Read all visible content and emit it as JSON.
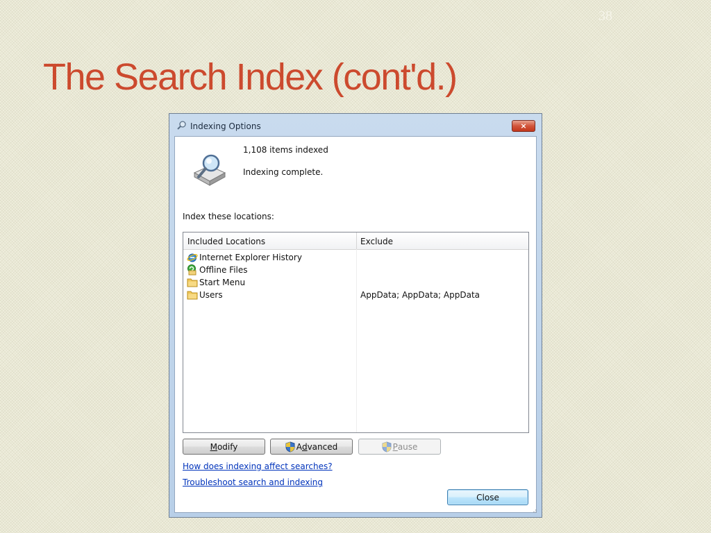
{
  "slide": {
    "number": "38",
    "title": "The Search Index (cont'd.)"
  },
  "window": {
    "title": "Indexing Options",
    "close_glyph": "×"
  },
  "status": {
    "items_indexed": "1,108 items indexed",
    "message": "Indexing complete."
  },
  "locations": {
    "label": "Index these locations:",
    "columns": {
      "included": "Included Locations",
      "exclude": "Exclude"
    },
    "rows": [
      {
        "name": "Internet Explorer History",
        "icon": "internet-explorer-icon",
        "exclude": ""
      },
      {
        "name": "Offline Files",
        "icon": "offline-files-icon",
        "exclude": ""
      },
      {
        "name": "Start Menu",
        "icon": "folder-icon",
        "exclude": ""
      },
      {
        "name": "Users",
        "icon": "folder-icon",
        "exclude": "AppData; AppData; AppData"
      }
    ]
  },
  "buttons": {
    "modify": {
      "label": "Modify",
      "accel": "M",
      "rest": "odify"
    },
    "advanced": {
      "label": "Advanced",
      "pre": "A",
      "accel": "d",
      "rest": "vanced",
      "icon": "uac-shield-icon"
    },
    "pause": {
      "label": "Pause",
      "accel": "P",
      "rest": "ause",
      "icon": "uac-shield-icon",
      "enabled": false
    },
    "close": {
      "label": "Close"
    }
  },
  "links": {
    "how_indexing": "How does indexing affect searches?",
    "troubleshoot": "Troubleshoot search and indexing"
  },
  "colors": {
    "title_red": "#cc4a2e",
    "background": "#efeedd",
    "link_blue": "#0033bb"
  }
}
